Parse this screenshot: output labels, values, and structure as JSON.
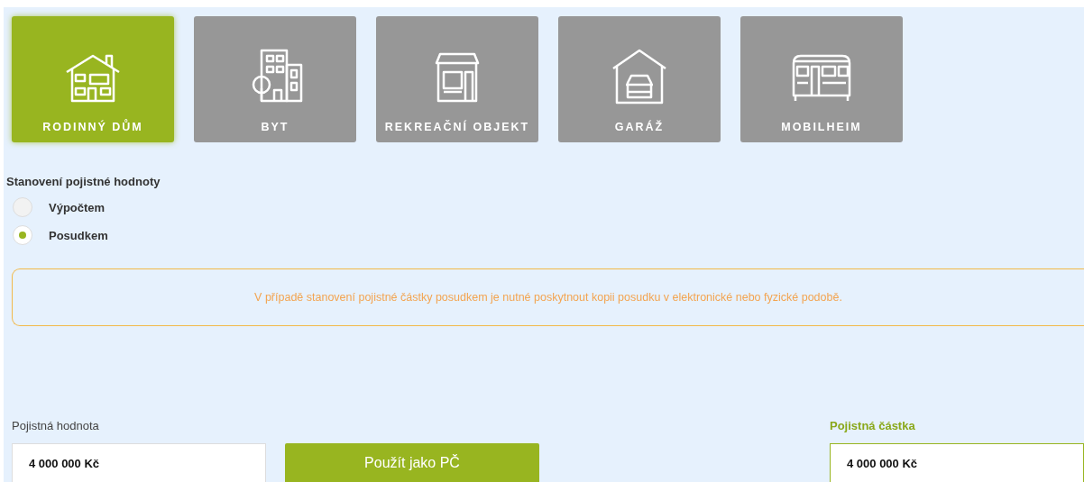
{
  "property_types": [
    {
      "label": "RODINNÝ DŮM",
      "selected": true
    },
    {
      "label": "BYT",
      "selected": false
    },
    {
      "label": "REKREAČNÍ OBJEKT",
      "selected": false
    },
    {
      "label": "GARÁŽ",
      "selected": false
    },
    {
      "label": "MOBILHEIM",
      "selected": false
    }
  ],
  "valuation": {
    "title": "Stanovení pojistné hodnoty",
    "options": [
      {
        "label": "Výpočtem",
        "selected": false
      },
      {
        "label": "Posudkem",
        "selected": true
      }
    ]
  },
  "notice": "V případě stanovení pojistné částky posudkem je nutné poskytnout kopii posudku v elektronické nebo fyzické podobě.",
  "insured_value": {
    "label": "Pojistná hodnota",
    "value": "4 000 000 Kč"
  },
  "use_button": "Použít jako PČ",
  "insured_amount": {
    "label": "Pojistná částka",
    "value": "4 000 000 Kč"
  }
}
